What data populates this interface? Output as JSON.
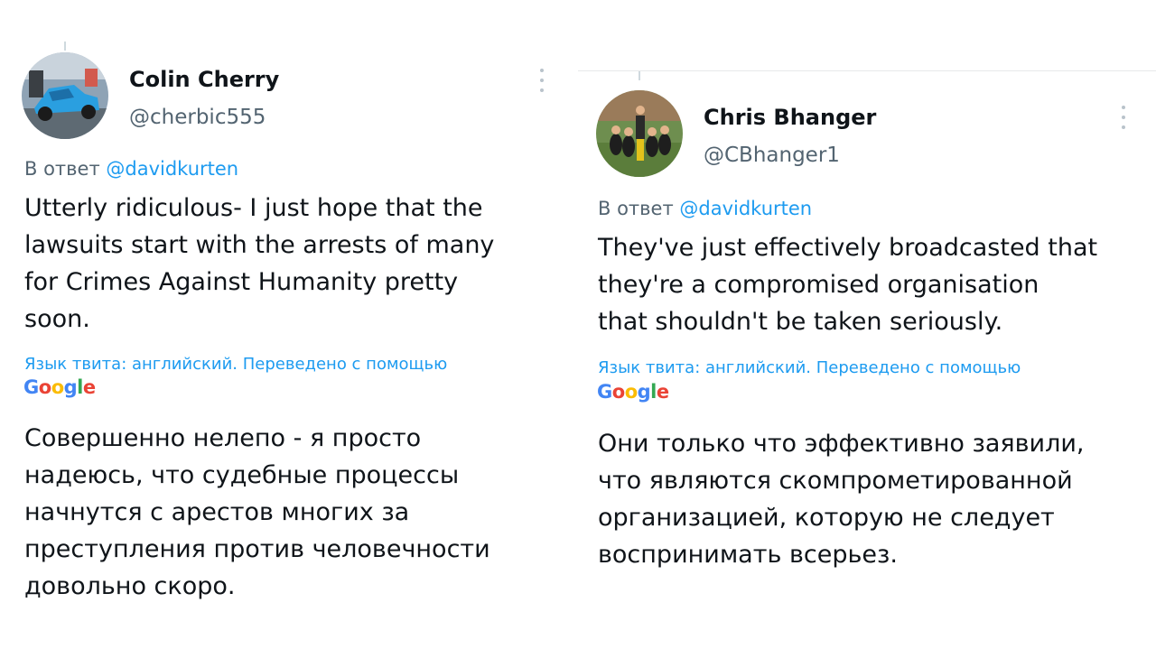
{
  "tweets": [
    {
      "author_name": "Colin Cherry",
      "author_handle": "@cherbic555",
      "reply_prefix": "В ответ",
      "reply_mention": "@davidkurten",
      "original_text": "Utterly ridiculous- I just hope that the\nlawsuits start with the arrests of many\nfor Crimes Against Humanity pretty\nsoon.",
      "translation_note": "Язык твита: английский. Переведено с помощью",
      "translation_provider": "Google",
      "translated_text": "Совершенно нелепо - я просто\nнадеюсь, что судебные процессы\nначнутся с арестов многих за\nпреступления против человечности\nдовольно скоро.",
      "avatar_icon": "race-car-avatar"
    },
    {
      "author_name": "Chris Bhanger",
      "author_handle": "@CBhanger1",
      "reply_prefix": "В ответ",
      "reply_mention": "@davidkurten",
      "original_text": "They've just effectively broadcasted that\nthey're  a compromised organisation\nthat shouldn't be taken seriously.",
      "translation_note": "Язык твита: английский. Переведено с помощью",
      "translation_provider": "Google",
      "translated_text": "Они только что эффективно заявили,\nчто являются скомпрометированной\nорганизацией, которую не следует\nвоспринимать всерьез.",
      "avatar_icon": "team-photo-avatar"
    }
  ],
  "colors": {
    "link": "#1d9bf0",
    "secondary_text": "#536471",
    "primary_text": "#0f1419"
  }
}
